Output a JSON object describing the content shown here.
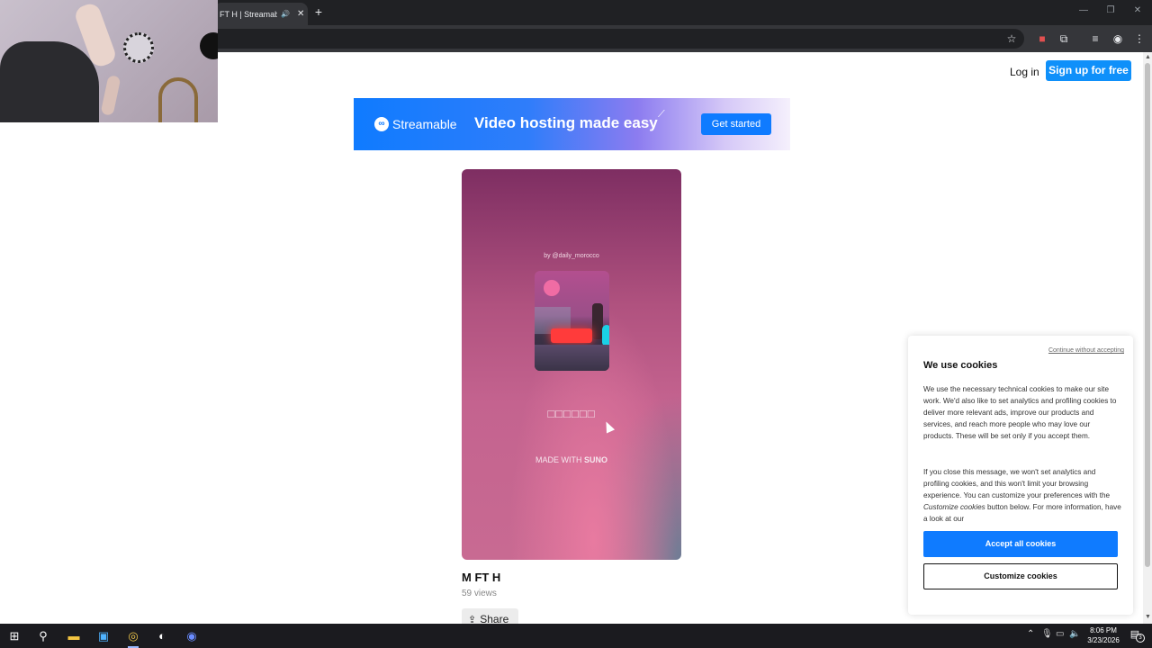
{
  "browser": {
    "tab_title": "FT H | Streamable",
    "tab_audio_icon": "speaker-icon",
    "tab_close": "✕",
    "new_tab": "+",
    "toolbar_icons": [
      "star-icon",
      "extension-shield-icon",
      "puzzle-icon",
      "media-control-icon",
      "profile-icon",
      "menu-icon"
    ]
  },
  "header": {
    "login_label": "Log in",
    "signup_label": "Sign up for free"
  },
  "banner": {
    "brand": "Streamable",
    "tagline": "Video hosting made easy",
    "cta_label": "Get started"
  },
  "video": {
    "byline": "by @daily_morocco",
    "song_title": "□□□□□□",
    "made_with_prefix": "MADE WITH ",
    "made_with_brand": "SUNO",
    "title": "M FT H",
    "views": "59 views",
    "share_label": "Share"
  },
  "cookie": {
    "continue_label": "Continue without accepting",
    "heading": "We use cookies",
    "paragraph1": "We use the necessary technical cookies to make our site work. We'd also like to set analytics and profiling cookies to deliver more relevant ads, improve our products and services, and reach more people who may love our products. These will be set only if you accept them.",
    "paragraph2_before": "If you close this message, we won't set analytics and profiling cookies, and this won't limit your browsing experience. You can customize your preferences with the ",
    "paragraph2_em": "Customize cookies",
    "paragraph2_after": " button below. For more information, have a look at our",
    "accept_label": "Accept all cookies",
    "customize_label": "Customize cookies"
  },
  "taskbar": {
    "time": "8:06 PM",
    "date": "3/23/2026",
    "notification_count": "3",
    "apps": [
      "windows-start-icon",
      "search-icon",
      "file-explorer-icon",
      "store-icon",
      "chrome-icon",
      "obs-icon",
      "chrome-profile-icon"
    ]
  },
  "colors": {
    "accent": "#0f90fa",
    "banner_blue": "#0f7bff"
  }
}
